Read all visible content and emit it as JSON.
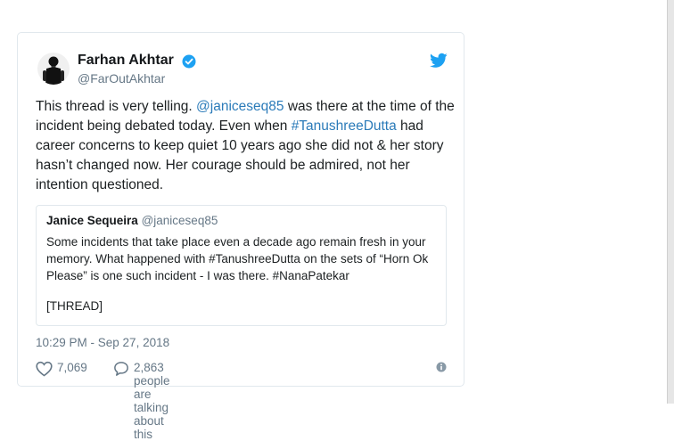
{
  "tweet": {
    "author_name": "Farhan Akhtar",
    "author_handle": "@FarOutAkhtar",
    "text_part1": "This thread is very telling. ",
    "mention": "@janiceseq85",
    "text_part2": " was there at the time of the incident being debated today. Even when ",
    "hashtag": "#TanushreeDutta",
    "text_part3": " had career concerns to keep quiet 10 years ago she did not & her story hasn’t changed now. Her courage should be admired, not her intention questioned.",
    "timestamp": "10:29 PM - Sep 27, 2018",
    "likes": "7,069",
    "talking": "2,863 people are talking about this"
  },
  "quote": {
    "author_name": "Janice Sequeira",
    "author_handle": "@janiceseq85",
    "text": "Some incidents that take place even a decade ago remain fresh in your memory. What happened with #TanushreeDutta on the sets of “Horn Ok Please” is one such incident - I was there. #NanaPatekar",
    "thread_label": "[THREAD]"
  },
  "icons": {
    "verified": "verified-badge-icon",
    "brand": "twitter-bird-icon",
    "like": "heart-icon",
    "reply": "speech-bubble-icon",
    "info": "info-icon"
  },
  "colors": {
    "link": "#2b7bb9",
    "verified": "#1da1f2",
    "muted": "#657786",
    "border": "#e1e8ed"
  }
}
